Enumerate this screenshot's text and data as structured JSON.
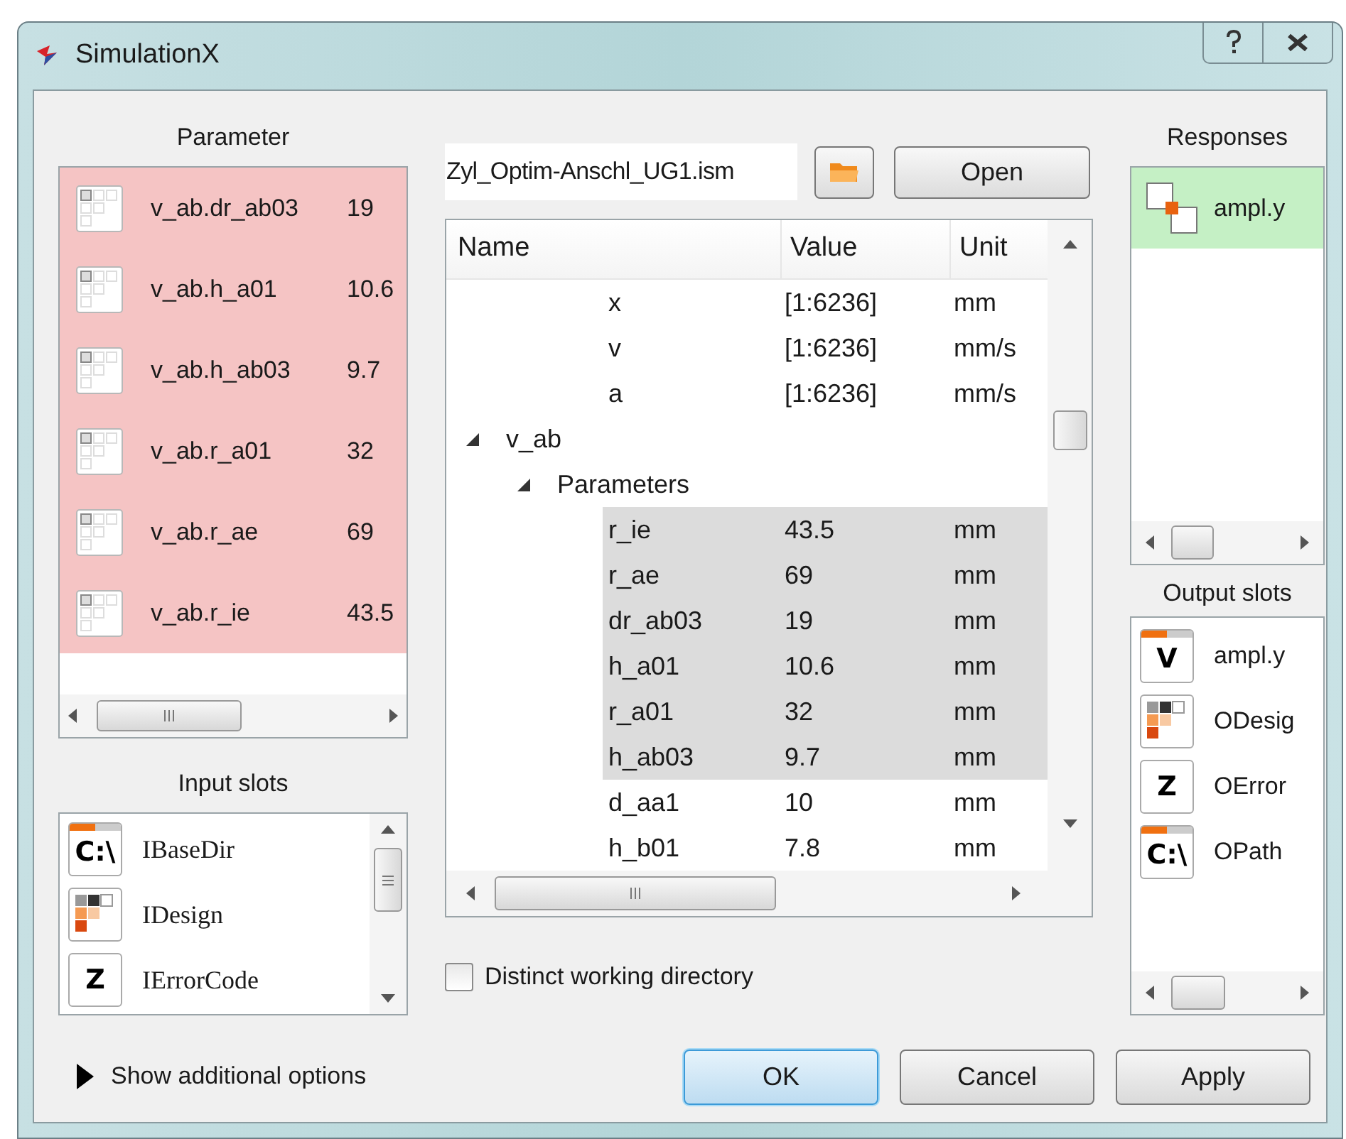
{
  "window": {
    "title": "SimulationX"
  },
  "parameter": {
    "label": "Parameter",
    "items": [
      {
        "name": "v_ab.dr_ab03",
        "value": "19"
      },
      {
        "name": "v_ab.h_a01",
        "value": "10.6"
      },
      {
        "name": "v_ab.h_ab03",
        "value": "9.7"
      },
      {
        "name": "v_ab.r_a01",
        "value": "32"
      },
      {
        "name": "v_ab.r_ae",
        "value": "69"
      },
      {
        "name": "v_ab.r_ie",
        "value": "43.5"
      }
    ]
  },
  "input_slots": {
    "label": "Input slots",
    "items": [
      {
        "kind": "path",
        "icon_text": "C:\\",
        "name": "IBaseDir"
      },
      {
        "kind": "design",
        "name": "IDesign"
      },
      {
        "kind": "error",
        "icon_text": "Z",
        "name": "IErrorCode"
      }
    ]
  },
  "show_options": {
    "label": "Show additional options",
    "expanded": false
  },
  "file": {
    "value": "Zyl_Optim-Anschl_UG1.ism"
  },
  "open_button": "Open",
  "tree": {
    "columns": [
      "Name",
      "Value",
      "Unit"
    ],
    "items": [
      {
        "children": [
          {
            "children": [
              {
                "name": "x",
                "value": "[1:6236]",
                "unit": "mm",
                "selected": false
              },
              {
                "name": "v",
                "value": "[1:6236]",
                "unit": "mm/s",
                "selected": false
              },
              {
                "name": "a",
                "value": "[1:6236]",
                "unit": "mm/s",
                "selected": false
              }
            ]
          }
        ]
      },
      {
        "name": "v_ab",
        "expanded": true,
        "children": [
          {
            "name": "Parameters",
            "expanded": true,
            "children": [
              {
                "name": "r_ie",
                "value": "43.5",
                "unit": "mm",
                "selected": true
              },
              {
                "name": "r_ae",
                "value": "69",
                "unit": "mm",
                "selected": true
              },
              {
                "name": "dr_ab03",
                "value": "19",
                "unit": "mm",
                "selected": true
              },
              {
                "name": "h_a01",
                "value": "10.6",
                "unit": "mm",
                "selected": true
              },
              {
                "name": "r_a01",
                "value": "32",
                "unit": "mm",
                "selected": true
              },
              {
                "name": "h_ab03",
                "value": "9.7",
                "unit": "mm",
                "selected": true
              },
              {
                "name": "d_aa1",
                "value": "10",
                "unit": "mm",
                "selected": false
              },
              {
                "name": "h_b01",
                "value": "7.8",
                "unit": "mm",
                "selected": false
              }
            ]
          }
        ]
      }
    ]
  },
  "distinct_dir": {
    "label": "Distinct working directory",
    "checked": false
  },
  "responses": {
    "label": "Responses",
    "items": [
      {
        "name": "ampl.y"
      }
    ]
  },
  "output_slots": {
    "label": "Output slots",
    "items": [
      {
        "kind": "value",
        "icon_text": "V",
        "name": "ampl.y"
      },
      {
        "kind": "design",
        "name": "ODesig"
      },
      {
        "kind": "error",
        "icon_text": "Z",
        "name": "OError"
      },
      {
        "kind": "path",
        "icon_text": "C:\\",
        "name": "OPath"
      }
    ]
  },
  "buttons": [
    {
      "label": "OK",
      "default": true
    },
    {
      "label": "Cancel",
      "default": false
    },
    {
      "label": "Apply",
      "default": false
    }
  ]
}
